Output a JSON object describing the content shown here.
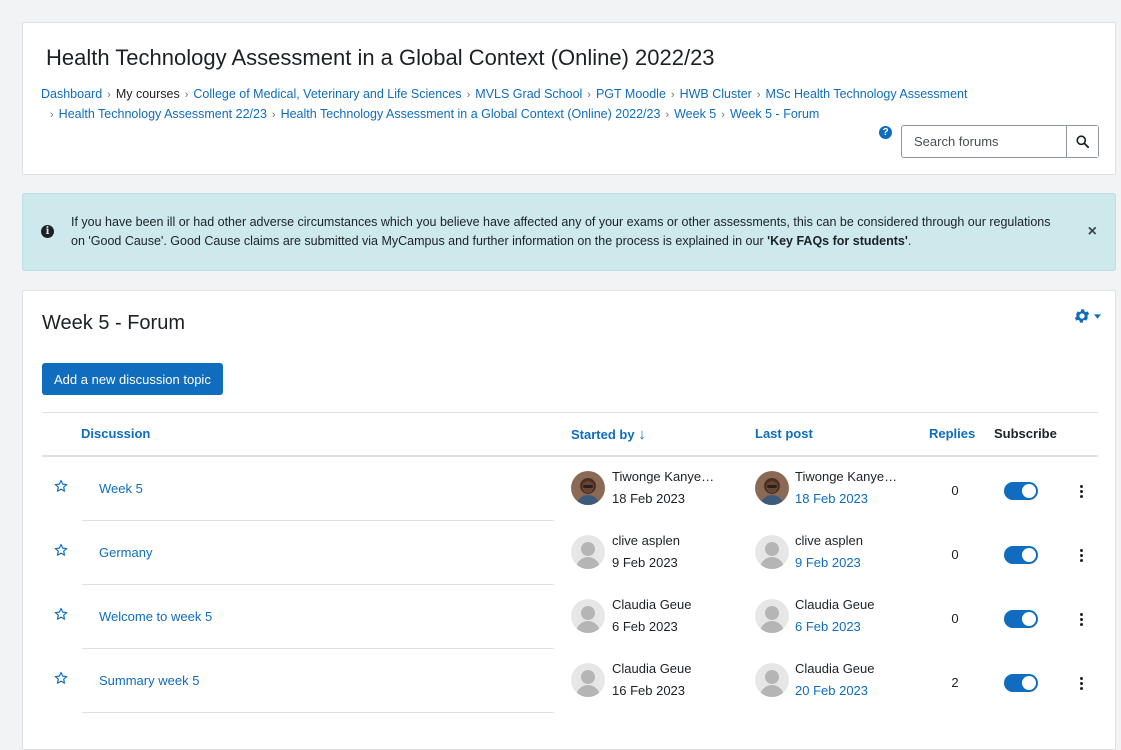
{
  "header": {
    "title": "Health Technology Assessment in a Global Context (Online) 2022/23",
    "breadcrumb_line1": [
      "Dashboard",
      "My courses",
      "College of Medical, Veterinary and Life Sciences",
      "MVLS Grad School",
      "PGT Moodle",
      "HWB Cluster",
      "MSc Health Technology Assessment"
    ],
    "breadcrumb_line2": [
      "Health Technology Assessment 22/23",
      "Health Technology Assessment in a Global Context (Online) 2022/23",
      "Week 5",
      "Week 5 - Forum"
    ],
    "search_placeholder": "Search forums",
    "help_glyph": "?"
  },
  "alert": {
    "info_glyph": "i",
    "text_before": "If you have been ill or had other adverse circumstances which you believe have affected any of your exams or other assessments, this can be considered through our regulations on 'Good Cause'. Good Cause claims are submitted via MyCampus and further information on the process is explained in our ",
    "text_bold": "'Key FAQs for students'",
    "text_after": ".",
    "close_glyph": "×"
  },
  "forum": {
    "title": "Week 5 - Forum",
    "add_button_label": "Add a new discussion topic",
    "columns": {
      "discussion": "Discussion",
      "started_by": "Started by",
      "sort_arrow": "↓",
      "last_post": "Last post",
      "replies": "Replies",
      "subscribe": "Subscribe"
    },
    "rows": [
      {
        "title": "Week 5",
        "started_by": "Tiwonge Kanye…",
        "started_date": "18 Feb 2023",
        "last_by": "Tiwonge Kanye…",
        "last_date": "18 Feb 2023",
        "replies": "0",
        "subscribed": true,
        "avatar": "photo"
      },
      {
        "title": "Germany",
        "started_by": "clive asplen",
        "started_date": "9 Feb 2023",
        "last_by": "clive asplen",
        "last_date": "9 Feb 2023",
        "replies": "0",
        "subscribed": true,
        "avatar": "default"
      },
      {
        "title": "Welcome to week 5",
        "started_by": "Claudia Geue",
        "started_date": "6 Feb 2023",
        "last_by": "Claudia Geue",
        "last_date": "6 Feb 2023",
        "replies": "0",
        "subscribed": true,
        "avatar": "default"
      },
      {
        "title": "Summary week 5",
        "started_by": "Claudia Geue",
        "started_date": "16 Feb 2023",
        "last_by": "Claudia Geue",
        "last_date": "20 Feb 2023",
        "replies": "2",
        "subscribed": true,
        "avatar": "default"
      }
    ]
  },
  "colors": {
    "primary": "#0f6cbf",
    "alert_bg": "#cde9ec",
    "page_bg": "#f1f3f5"
  }
}
